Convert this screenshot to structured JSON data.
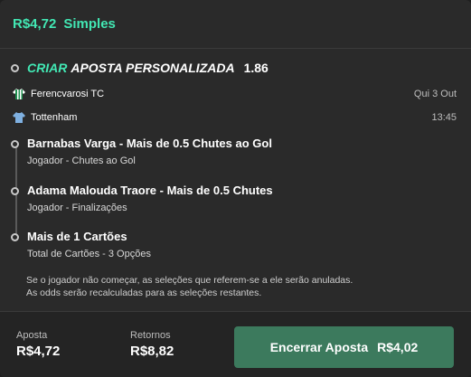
{
  "header": {
    "amount": "R$4,72",
    "type": "Simples"
  },
  "selection": {
    "label_highlight": "CRIAR",
    "label_rest": "APOSTA PERSONALIZADA",
    "odds": "1.86"
  },
  "match": {
    "home": {
      "name": "Ferencvarosi TC",
      "date": "Qui 3 Out"
    },
    "away": {
      "name": "Tottenham",
      "time": "13:45"
    }
  },
  "legs": [
    {
      "title": "Barnabas Varga - Mais de 0.5 Chutes ao Gol",
      "subtitle": "Jogador - Chutes ao Gol"
    },
    {
      "title": "Adama Malouda Traore - Mais de 0.5 Chutes",
      "subtitle": "Jogador - Finalizações"
    },
    {
      "title": "Mais de 1 Cartões",
      "subtitle": "Total de Cartões - 3 Opções"
    }
  ],
  "notice": {
    "line1": "Se o jogador não começar, as seleções que referem-se a ele serão anuladas.",
    "line2": "As odds serão recalculadas para as seleções restantes."
  },
  "footer": {
    "stake_label": "Aposta",
    "stake_value": "R$4,72",
    "returns_label": "Retornos",
    "returns_value": "R$8,82",
    "cashout_label": "Encerrar Aposta",
    "cashout_value": "R$4,02"
  },
  "colors": {
    "accent": "#42e8b4",
    "cashout_bg": "#3c7a5d",
    "home_shirt": "#1e8f4e",
    "away_shirt": "#7fb0e0"
  },
  "icons": {
    "home_shirt": "shirt-icon",
    "away_shirt": "shirt-icon"
  }
}
